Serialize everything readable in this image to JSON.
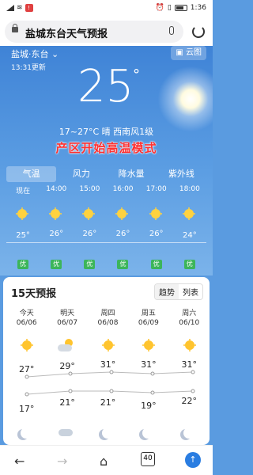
{
  "status": {
    "time": "1:36",
    "icons": [
      "signal-icon",
      "wifi-icon",
      "notification-icon",
      "alarm-icon",
      "vibrate-icon",
      "battery-icon"
    ]
  },
  "browser": {
    "query": "盐城东台天气预报",
    "tab_count": "40"
  },
  "current": {
    "location": "盐城·东台",
    "updated": "13:31更新",
    "cloud_button": "云图",
    "temp": "25",
    "degree": "°",
    "desc": "17~27°C  晴  西南风1级",
    "banner": "产区开始高温模式"
  },
  "tabs": [
    {
      "label": "气温",
      "active": true
    },
    {
      "label": "风力",
      "active": false
    },
    {
      "label": "降水量",
      "active": false
    },
    {
      "label": "紫外线",
      "active": false
    }
  ],
  "hourly": [
    {
      "time": "现在",
      "temp": "25°",
      "aqi": "优",
      "icon": "sunny-icon"
    },
    {
      "time": "14:00",
      "temp": "26°",
      "aqi": "优",
      "icon": "sunny-icon"
    },
    {
      "time": "15:00",
      "temp": "26°",
      "aqi": "优",
      "icon": "sunny-icon"
    },
    {
      "time": "16:00",
      "temp": "26°",
      "aqi": "优",
      "icon": "sunny-icon"
    },
    {
      "time": "17:00",
      "temp": "26°",
      "aqi": "优",
      "icon": "sunny-icon"
    },
    {
      "time": "18:00",
      "temp": "24°",
      "aqi": "优",
      "icon": "sunny-icon"
    }
  ],
  "forecast": {
    "title": "15天预报",
    "toggle": [
      "趋势",
      "列表"
    ],
    "days": [
      {
        "name": "今天",
        "date": "06/06",
        "high": "27°",
        "low": "17°",
        "day_icon": "sunny-icon",
        "night_icon": "moon-icon"
      },
      {
        "name": "明天",
        "date": "06/07",
        "high": "29°",
        "low": "21°",
        "day_icon": "partly-cloudy-icon",
        "night_icon": "rain-cloud-icon"
      },
      {
        "name": "周四",
        "date": "06/08",
        "high": "31°",
        "low": "21°",
        "day_icon": "sunny-icon",
        "night_icon": "moon-icon"
      },
      {
        "name": "周五",
        "date": "06/09",
        "high": "31°",
        "low": "19°",
        "day_icon": "sunny-icon",
        "night_icon": "moon-icon"
      },
      {
        "name": "周六",
        "date": "06/10",
        "high": "31°",
        "low": "22°",
        "day_icon": "sunny-icon",
        "night_icon": "moon-icon"
      }
    ]
  }
}
